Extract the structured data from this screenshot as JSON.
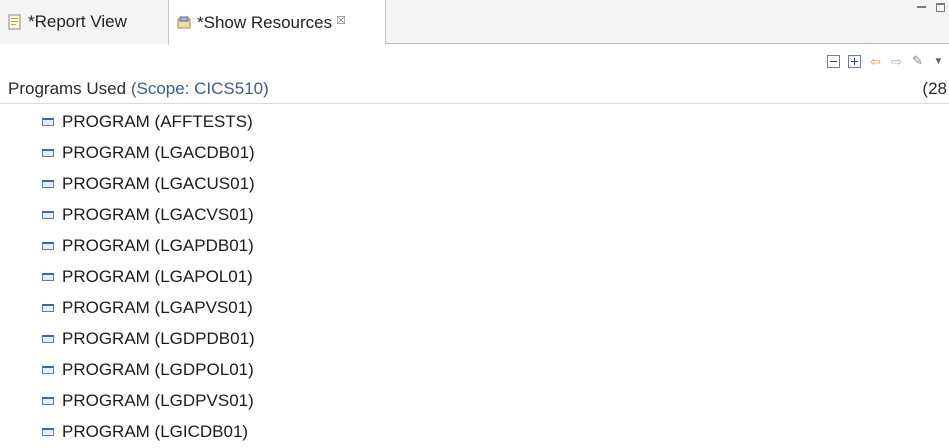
{
  "tabs": [
    {
      "label": "*Report View",
      "icon": "report-icon",
      "active": false
    },
    {
      "label": "*Show Resources",
      "icon": "resources-icon",
      "active": true,
      "close": "☒"
    }
  ],
  "toolbar": {
    "icons": [
      "collapse-all-icon",
      "expand-all-icon",
      "back-arrow-icon",
      "forward-arrow-icon",
      "edit-icon",
      "view-menu-icon"
    ]
  },
  "header": {
    "prefix": "Programs Used",
    "scope": " (Scope: CICS510)",
    "count": "(28"
  },
  "items": [
    {
      "label": "PROGRAM (AFFTESTS)"
    },
    {
      "label": "PROGRAM (LGACDB01)"
    },
    {
      "label": "PROGRAM (LGACUS01)"
    },
    {
      "label": "PROGRAM (LGACVS01)"
    },
    {
      "label": "PROGRAM (LGAPDB01)"
    },
    {
      "label": "PROGRAM (LGAPOL01)"
    },
    {
      "label": "PROGRAM (LGAPVS01)"
    },
    {
      "label": "PROGRAM (LGDPDB01)"
    },
    {
      "label": "PROGRAM (LGDPOL01)"
    },
    {
      "label": "PROGRAM (LGDPVS01)"
    },
    {
      "label": "PROGRAM (LGICDB01)"
    }
  ]
}
